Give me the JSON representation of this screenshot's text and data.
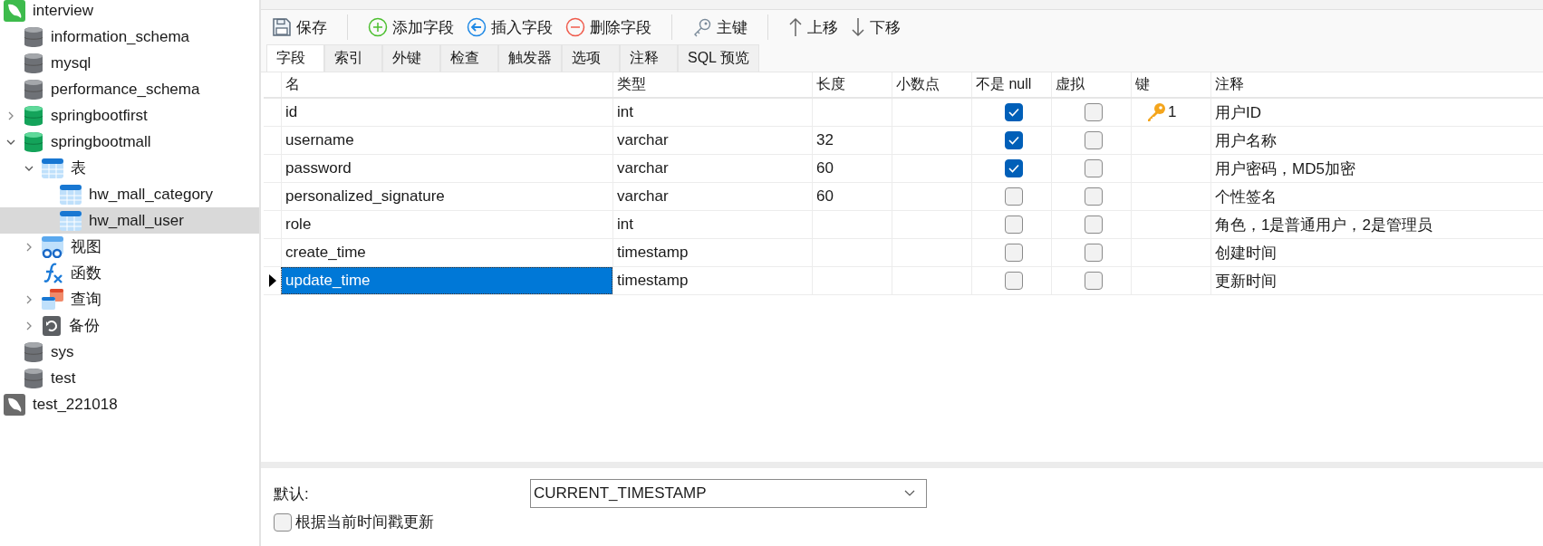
{
  "sidebar": {
    "items": [
      {
        "kind": "connection",
        "label": "interview",
        "open": true,
        "selected": false,
        "children": [
          {
            "kind": "database",
            "label": "information_schema",
            "open": false,
            "selected": false
          },
          {
            "kind": "database",
            "label": "mysql",
            "open": false,
            "selected": false
          },
          {
            "kind": "database",
            "label": "performance_schema",
            "open": false,
            "selected": false
          },
          {
            "kind": "database",
            "label": "springbootfirst",
            "open": true,
            "selected": false,
            "expanded": false
          },
          {
            "kind": "database",
            "label": "springbootmall",
            "open": true,
            "selected": false,
            "expanded": true,
            "children": [
              {
                "kind": "tables",
                "label": "表",
                "selected": false,
                "expanded": true,
                "children": [
                  {
                    "kind": "table",
                    "label": "hw_mall_category",
                    "selected": false
                  },
                  {
                    "kind": "table",
                    "label": "hw_mall_user",
                    "selected": true
                  }
                ]
              },
              {
                "kind": "views",
                "label": "视图",
                "selected": false,
                "expanded": false
              },
              {
                "kind": "functions",
                "label": "函数",
                "selected": false
              },
              {
                "kind": "queries",
                "label": "查询",
                "selected": false,
                "expanded": false
              },
              {
                "kind": "backups",
                "label": "备份",
                "selected": false,
                "expanded": false
              }
            ]
          },
          {
            "kind": "database",
            "label": "sys",
            "open": false,
            "selected": false
          },
          {
            "kind": "database",
            "label": "test",
            "open": false,
            "selected": false
          }
        ]
      },
      {
        "kind": "connection",
        "label": "test_221018",
        "open": false,
        "selected": false
      }
    ]
  },
  "toolbar": [
    {
      "buttons": [
        {
          "kind": "save",
          "label": "保存"
        }
      ]
    },
    {
      "buttons": [
        {
          "kind": "add",
          "label": "添加字段"
        },
        {
          "kind": "insert",
          "label": "插入字段"
        },
        {
          "kind": "delete",
          "label": "删除字段"
        }
      ]
    },
    {
      "buttons": [
        {
          "kind": "key",
          "label": "主键"
        }
      ]
    },
    {
      "buttons": [
        {
          "kind": "up",
          "label": "上移"
        },
        {
          "kind": "down",
          "label": "下移"
        }
      ]
    }
  ],
  "tabs": [
    {
      "label": "字段",
      "selected": true
    },
    {
      "label": "索引",
      "selected": false
    },
    {
      "label": "外键",
      "selected": false
    },
    {
      "label": "检查",
      "selected": false
    },
    {
      "label": "触发器",
      "selected": false
    },
    {
      "label": "选项",
      "selected": false
    },
    {
      "label": "注释",
      "selected": false
    },
    {
      "label": "SQL 预览",
      "selected": false
    }
  ],
  "table": {
    "columns": [
      "名",
      "类型",
      "长度",
      "小数点",
      "不是 null",
      "虚拟",
      "键",
      "注释"
    ],
    "rows": [
      {
        "name": "id",
        "type": "int",
        "not_null": true,
        "virtual": false,
        "key": "1",
        "comment": "用户ID",
        "current": false
      },
      {
        "name": "username",
        "type": "varchar",
        "length": "32",
        "not_null": true,
        "virtual": false,
        "comment": "用户名称",
        "current": false
      },
      {
        "name": "password",
        "type": "varchar",
        "length": "60",
        "not_null": true,
        "virtual": false,
        "comment": "用户密码，MD5加密",
        "current": false
      },
      {
        "name": "personalized_signature",
        "type": "varchar",
        "length": "60",
        "not_null": false,
        "virtual": false,
        "comment": "个性签名",
        "current": false
      },
      {
        "name": "role",
        "type": "int",
        "not_null": false,
        "virtual": false,
        "comment": "角色，1是普通用户，2是管理员",
        "current": false
      },
      {
        "name": "create_time",
        "type": "timestamp",
        "not_null": false,
        "virtual": false,
        "comment": "创建时间",
        "current": false
      },
      {
        "name": "update_time",
        "type": "timestamp",
        "not_null": false,
        "virtual": false,
        "comment": "更新时间",
        "current": true
      }
    ]
  },
  "properties": {
    "default_label": "默认:",
    "default_value": "CURRENT_TIMESTAMP",
    "on_update": {
      "label": "根据当前时间戳更新",
      "checked": false
    }
  }
}
